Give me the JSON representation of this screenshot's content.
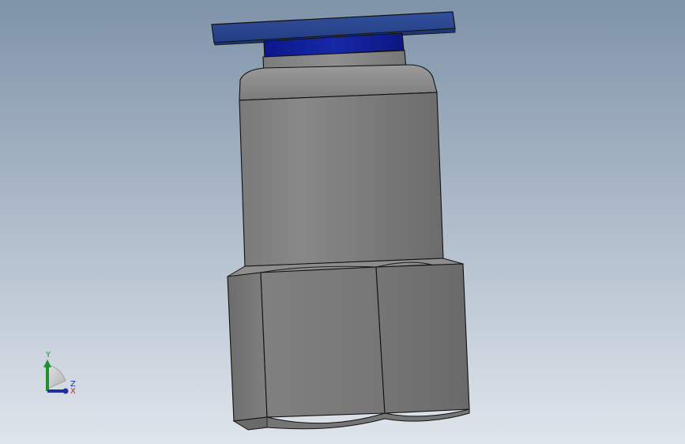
{
  "viewport": {
    "background_top": "#7f93a9",
    "background_bottom": "#dfe5ec"
  },
  "model": {
    "cap_color": "#233f86",
    "collar_color": "#0f1f8f",
    "body_color": "#8a8a8a",
    "edge_color": "#1c1c1c"
  },
  "triad": {
    "y_label": "Y",
    "z_label": "Z",
    "x_label": "X",
    "y_color": "#1f8f2f",
    "z_color": "#1f2f9f",
    "x_color": "#c61f1f"
  }
}
